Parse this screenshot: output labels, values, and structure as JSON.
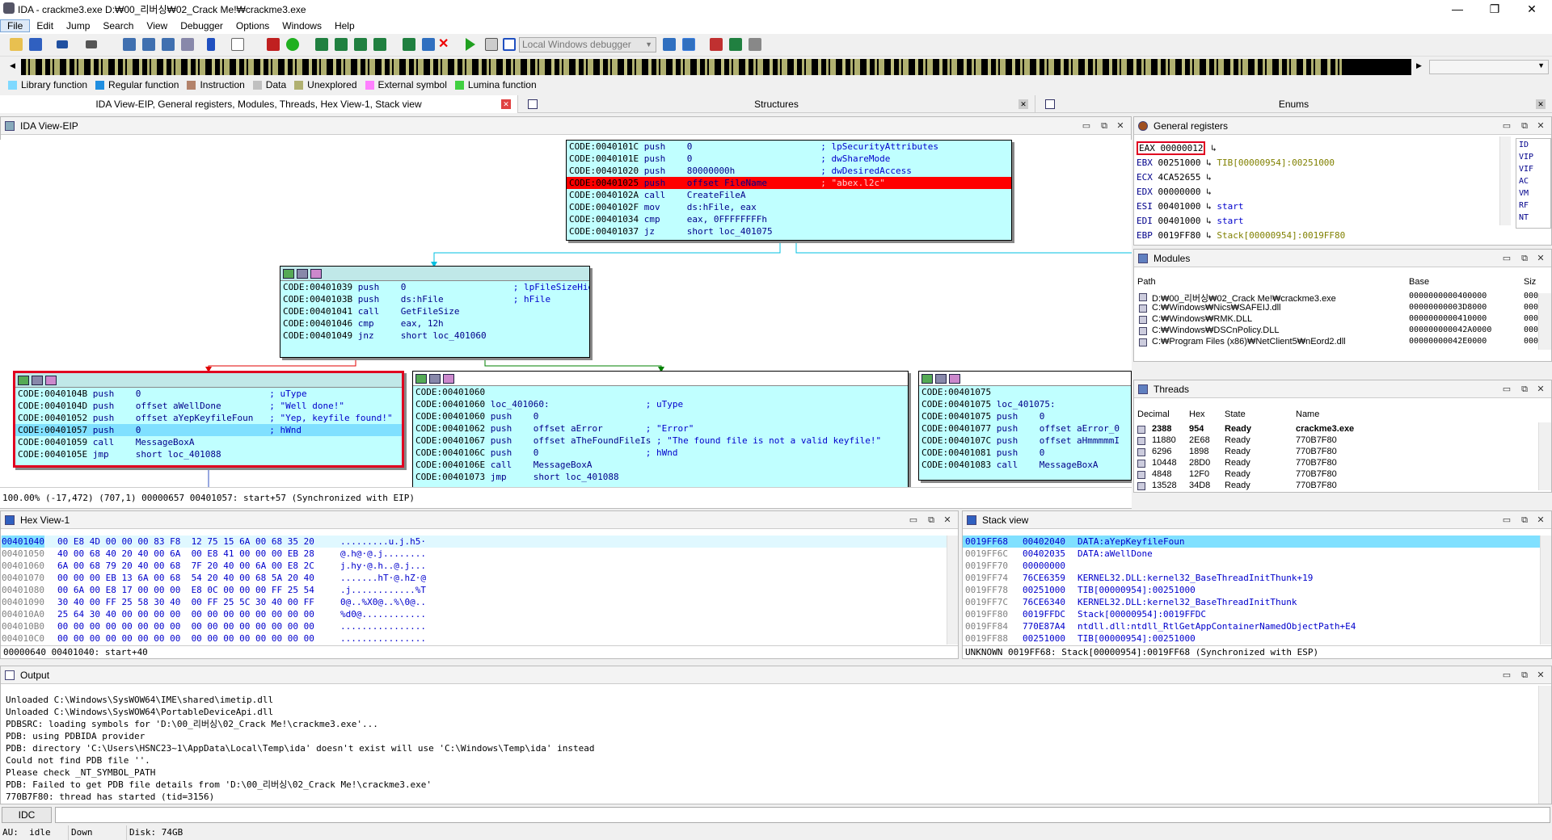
{
  "window": {
    "title": "IDA - crackme3.exe D:₩00_리버싱₩02_Crack Me!₩crackme3.exe",
    "min": "—",
    "max": "❐",
    "close": "✕"
  },
  "menu": [
    "File",
    "Edit",
    "Jump",
    "Search",
    "View",
    "Debugger",
    "Options",
    "Windows",
    "Help"
  ],
  "toolbar": {
    "debugger_select": "Local Windows debugger"
  },
  "legend": [
    {
      "label": "Library function",
      "color": "#7fd9ff"
    },
    {
      "label": "Regular function",
      "color": "#1f8ee0"
    },
    {
      "label": "Instruction",
      "color": "#b3826a"
    },
    {
      "label": "Data",
      "color": "#c0c0c0"
    },
    {
      "label": "Unexplored",
      "color": "#b0b070"
    },
    {
      "label": "External symbol",
      "color": "#ff80ff"
    },
    {
      "label": "Lumina function",
      "color": "#40d040"
    }
  ],
  "tabs": [
    {
      "label": "IDA View-EIP, General registers, Modules, Threads, Hex View-1, Stack view"
    },
    {
      "label": "Structures"
    },
    {
      "label": "Enums"
    }
  ],
  "ida_view": {
    "title": "IDA View-EIP",
    "status": "100.00% (-17,472) (707,1) 00000657 00401057: start+57 (Synchronized with EIP)",
    "node_top": [
      {
        "addr": "CODE:0040101C",
        "op": "push",
        "arg": "0",
        "cmt": "; lpSecurityAttributes"
      },
      {
        "addr": "CODE:0040101E",
        "op": "push",
        "arg": "0",
        "cmt": "; dwShareMode"
      },
      {
        "addr": "CODE:00401020",
        "op": "push",
        "arg": "80000000h",
        "cmt": "; dwDesiredAccess"
      },
      {
        "addr": "CODE:00401025",
        "op": "push",
        "arg": "offset FileName",
        "cmt": "; \"abex.l2c\""
      },
      {
        "addr": "CODE:0040102A",
        "op": "call",
        "arg": "CreateFileA",
        "cmt": ""
      },
      {
        "addr": "CODE:0040102F",
        "op": "mov",
        "arg": "ds:hFile, eax",
        "cmt": ""
      },
      {
        "addr": "CODE:00401034",
        "op": "cmp",
        "arg": "eax, 0FFFFFFFFh",
        "cmt": ""
      },
      {
        "addr": "CODE:00401037",
        "op": "jz",
        "arg": "short loc_401075",
        "cmt": ""
      }
    ],
    "node_mid": [
      {
        "addr": "CODE:00401039",
        "op": "push",
        "arg": "0",
        "cmt": "; lpFileSizeHigh"
      },
      {
        "addr": "CODE:0040103B",
        "op": "push",
        "arg": "ds:hFile",
        "cmt": "; hFile"
      },
      {
        "addr": "CODE:00401041",
        "op": "call",
        "arg": "GetFileSize",
        "cmt": ""
      },
      {
        "addr": "CODE:00401046",
        "op": "cmp",
        "arg": "eax, 12h",
        "cmt": ""
      },
      {
        "addr": "CODE:00401049",
        "op": "jnz",
        "arg": "short loc_401060",
        "cmt": ""
      }
    ],
    "node_left": [
      {
        "addr": "CODE:0040104B",
        "op": "push",
        "arg": "0",
        "cmt": "; uType"
      },
      {
        "addr": "CODE:0040104D",
        "op": "push",
        "arg": "offset aWellDone",
        "cmt": "; \"Well done!\""
      },
      {
        "addr": "CODE:00401052",
        "op": "push",
        "arg": "offset aYepKeyfileFoun",
        "cmt": "; \"Yep, keyfile found!\""
      },
      {
        "addr": "CODE:00401057",
        "op": "push",
        "arg": "0",
        "cmt": "; hWnd"
      },
      {
        "addr": "CODE:00401059",
        "op": "call",
        "arg": "MessageBoxA",
        "cmt": ""
      },
      {
        "addr": "CODE:0040105E",
        "op": "jmp",
        "arg": "short loc_401088",
        "cmt": ""
      }
    ],
    "node_center": [
      {
        "addr": "CODE:00401060",
        "op": "",
        "arg": "",
        "cmt": ""
      },
      {
        "addr": "CODE:00401060",
        "op": "loc_401060:",
        "arg": "",
        "cmt": "; uType"
      },
      {
        "addr": "CODE:00401060",
        "op": "push",
        "arg": "0",
        "cmt": ""
      },
      {
        "addr": "CODE:00401062",
        "op": "push",
        "arg": "offset aError",
        "cmt": "; \"Error\""
      },
      {
        "addr": "CODE:00401067",
        "op": "push",
        "arg": "offset aTheFoundFileIs",
        "cmt": "; \"The found file is not a valid keyfile!\""
      },
      {
        "addr": "CODE:0040106C",
        "op": "push",
        "arg": "0",
        "cmt": "; hWnd"
      },
      {
        "addr": "CODE:0040106E",
        "op": "call",
        "arg": "MessageBoxA",
        "cmt": ""
      },
      {
        "addr": "CODE:00401073",
        "op": "jmp",
        "arg": "short loc_401088",
        "cmt": ""
      }
    ],
    "node_right": [
      {
        "addr": "CODE:00401075",
        "op": "",
        "arg": "",
        "cmt": ""
      },
      {
        "addr": "CODE:00401075",
        "op": "loc_401075:",
        "arg": "",
        "cmt": ""
      },
      {
        "addr": "CODE:00401075",
        "op": "push",
        "arg": "0",
        "cmt": ""
      },
      {
        "addr": "CODE:00401077",
        "op": "push",
        "arg": "offset aError_0",
        "cmt": ""
      },
      {
        "addr": "CODE:0040107C",
        "op": "push",
        "arg": "offset aHmmmmmI",
        "cmt": ""
      },
      {
        "addr": "CODE:00401081",
        "op": "push",
        "arg": "0",
        "cmt": ""
      },
      {
        "addr": "CODE:00401083",
        "op": "call",
        "arg": "MessageBoxA",
        "cmt": ""
      }
    ]
  },
  "registers": {
    "title": "General registers",
    "rows": [
      {
        "name": "EAX",
        "value": "00000012",
        "note": ""
      },
      {
        "name": "EBX",
        "value": "00251000",
        "note": "TIB[00000954]:00251000"
      },
      {
        "name": "ECX",
        "value": "4CA52655",
        "note": ""
      },
      {
        "name": "EDX",
        "value": "00000000",
        "note": ""
      },
      {
        "name": "ESI",
        "value": "00401000",
        "note": "start"
      },
      {
        "name": "EDI",
        "value": "00401000",
        "note": "start"
      },
      {
        "name": "EBP",
        "value": "0019FF80",
        "note": "Stack[00000954]:0019FF80"
      }
    ],
    "flags": [
      "ID",
      "VIP",
      "VIF",
      "AC",
      "VM",
      "RF",
      "NT"
    ]
  },
  "modules": {
    "title": "Modules",
    "headers": [
      "Path",
      "Base",
      "Siz"
    ],
    "rows": [
      {
        "path": "D:₩00_리버싱₩02_Crack Me!₩crackme3.exe",
        "base": "0000000000400000",
        "size": "000"
      },
      {
        "path": "C:₩Windows₩Nics₩SAFEIJ.dll",
        "base": "00000000003D8000",
        "size": "000"
      },
      {
        "path": "C:₩Windows₩RMK.DLL",
        "base": "0000000000410000",
        "size": "000"
      },
      {
        "path": "C:₩Windows₩DSCnPolicy.DLL",
        "base": "000000000042A0000",
        "size": "000"
      },
      {
        "path": "C:₩Program Files (x86)₩NetClient5₩nEord2.dll",
        "base": "00000000042E0000",
        "size": "000"
      }
    ]
  },
  "threads": {
    "title": "Threads",
    "headers": [
      "Decimal",
      "Hex",
      "State",
      "Name"
    ],
    "rows": [
      {
        "dec": "2388",
        "hex": "954",
        "state": "Ready",
        "name": "crackme3.exe"
      },
      {
        "dec": "11880",
        "hex": "2E68",
        "state": "Ready",
        "name": "770B7F80"
      },
      {
        "dec": "6296",
        "hex": "1898",
        "state": "Ready",
        "name": "770B7F80"
      },
      {
        "dec": "10448",
        "hex": "28D0",
        "state": "Ready",
        "name": "770B7F80"
      },
      {
        "dec": "4848",
        "hex": "12F0",
        "state": "Ready",
        "name": "770B7F80"
      },
      {
        "dec": "13528",
        "hex": "34D8",
        "state": "Ready",
        "name": "770B7F80"
      }
    ]
  },
  "hexview": {
    "title": "Hex View-1",
    "status": "00000640 00401040: start+40",
    "rows": [
      {
        "addr": "00401040",
        "bytes": "00 E8 4D 00 00 00 83 F8  12 75 15 6A 00 68 35 20",
        "ascii": ".........u.j.h5·"
      },
      {
        "addr": "00401050",
        "bytes": "40 00 68 40 20 40 00 6A  00 E8 41 00 00 00 EB 28",
        "ascii": "@.h@·@.j........"
      },
      {
        "addr": "00401060",
        "bytes": "6A 00 68 79 20 40 00 68  7F 20 40 00 6A 00 E8 2C",
        "ascii": "j.hy·@.h..@.j..."
      },
      {
        "addr": "00401070",
        "bytes": "00 00 00 EB 13 6A 00 68  54 20 40 00 68 5A 20 40",
        "ascii": ".......hT·@.hZ·@"
      },
      {
        "addr": "00401080",
        "bytes": "00 6A 00 E8 17 00 00 00  E8 0C 00 00 00 FF 25 54",
        "ascii": ".j............%T"
      },
      {
        "addr": "00401090",
        "bytes": "30 40 00 FF 25 58 30 40  00 FF 25 5C 30 40 00 FF",
        "ascii": "0@..%X0@..%\\0@.."
      },
      {
        "addr": "004010A0",
        "bytes": "25 64 30 40 00 00 00 00  00 00 00 00 00 00 00 00",
        "ascii": "%d0@............"
      },
      {
        "addr": "004010B0",
        "bytes": "00 00 00 00 00 00 00 00  00 00 00 00 00 00 00 00",
        "ascii": "................"
      },
      {
        "addr": "004010C0",
        "bytes": "00 00 00 00 00 00 00 00  00 00 00 00 00 00 00 00",
        "ascii": "................"
      }
    ]
  },
  "stack": {
    "title": "Stack view",
    "status": "UNKNOWN 0019FF68: Stack[00000954]:0019FF68 (Synchronized with ESP)",
    "rows": [
      {
        "addr": "0019FF68",
        "val": "00402040",
        "note": "DATA:aYepKeyfileFoun"
      },
      {
        "addr": "0019FF6C",
        "val": "00402035",
        "note": "DATA:aWellDone"
      },
      {
        "addr": "0019FF70",
        "val": "00000000",
        "note": ""
      },
      {
        "addr": "0019FF74",
        "val": "76CE6359",
        "note": "KERNEL32.DLL:kernel32_BaseThreadInitThunk+19"
      },
      {
        "addr": "0019FF78",
        "val": "00251000",
        "note": "TIB[00000954]:00251000"
      },
      {
        "addr": "0019FF7C",
        "val": "76CE6340",
        "note": "KERNEL32.DLL:kernel32_BaseThreadInitThunk"
      },
      {
        "addr": "0019FF80",
        "val": "0019FFDC",
        "note": "Stack[00000954]:0019FFDC"
      },
      {
        "addr": "0019FF84",
        "val": "770E87A4",
        "note": "ntdll.dll:ntdll_RtlGetAppContainerNamedObjectPath+E4"
      },
      {
        "addr": "0019FF88",
        "val": "00251000",
        "note": "TIB[00000954]:00251000"
      }
    ]
  },
  "output": {
    "title": "Output",
    "lines": [
      "Unloaded C:\\Windows\\SysWOW64\\IME\\shared\\imetip.dll",
      "Unloaded C:\\Windows\\SysWOW64\\PortableDeviceApi.dll",
      "PDBSRC: loading symbols for 'D:\\00_리버싱\\02_Crack Me!\\crackme3.exe'...",
      "PDB: using PDBIDA provider",
      "PDB: directory 'C:\\Users\\HSNC23~1\\AppData\\Local\\Temp\\ida' doesn't exist will use 'C:\\Windows\\Temp\\ida' instead",
      "Could not find PDB file ''.",
      "Please check _NT_SYMBOL_PATH",
      "PDB: Failed to get PDB file details from 'D:\\00_리버싱\\02_Crack Me!\\crackme3.exe'",
      "770B7F80: thread has started (tid=3156)"
    ],
    "idc_label": "IDC"
  },
  "statusbar": {
    "au": "AU:  idle",
    "dir": "Down",
    "disk": "Disk: 74GB"
  }
}
